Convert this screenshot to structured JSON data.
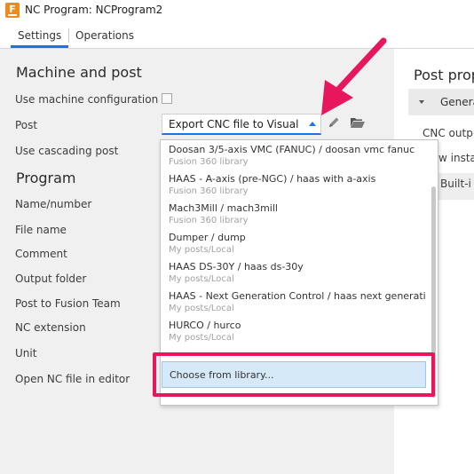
{
  "window": {
    "title": "NC Program: NCProgram2",
    "app_icon_letter": "F"
  },
  "tabs": [
    {
      "label": "Settings",
      "active": true
    },
    {
      "label": "Operations",
      "active": false
    }
  ],
  "machine_post": {
    "title": "Machine and post",
    "use_machine_config_label": "Use machine configuration",
    "post_label": "Post",
    "post_value": "Export CNC file to Visual S",
    "use_cascading_label": "Use cascading post"
  },
  "program": {
    "title": "Program",
    "labels": [
      "Name/number",
      "File name",
      "Comment",
      "Output folder",
      "Post to Fusion Team",
      "NC extension",
      "Unit",
      "Open NC file in editor"
    ]
  },
  "dropdown": {
    "items": [
      {
        "name": "Doosan 3/5-axis VMC (FANUC) / doosan vmc fanuc",
        "source": "Fusion 360 library"
      },
      {
        "name": "HAAS - A-axis (pre-NGC) / haas with a-axis",
        "source": "Fusion 360 library"
      },
      {
        "name": "Mach3Mill / mach3mill",
        "source": "Fusion 360 library"
      },
      {
        "name": "Dumper / dump",
        "source": "My posts/Local"
      },
      {
        "name": "HAAS DS-30Y / haas ds-30y",
        "source": "My posts/Local"
      },
      {
        "name": "HAAS - Next Generation Control / haas next generation",
        "source": "My posts/Local"
      },
      {
        "name": "HURCO / hurco",
        "source": "My posts/Local"
      }
    ],
    "choose_label": "Choose from library..."
  },
  "right_panel": {
    "title": "Post prop",
    "group_label": "Genera",
    "cnc_output": "CNC outpu",
    "new_install": "w insta",
    "built_in": "Built-i"
  },
  "colors": {
    "accent": "#1a73e8",
    "annotation": "#e8175d",
    "selection": "#d6e9f8"
  }
}
